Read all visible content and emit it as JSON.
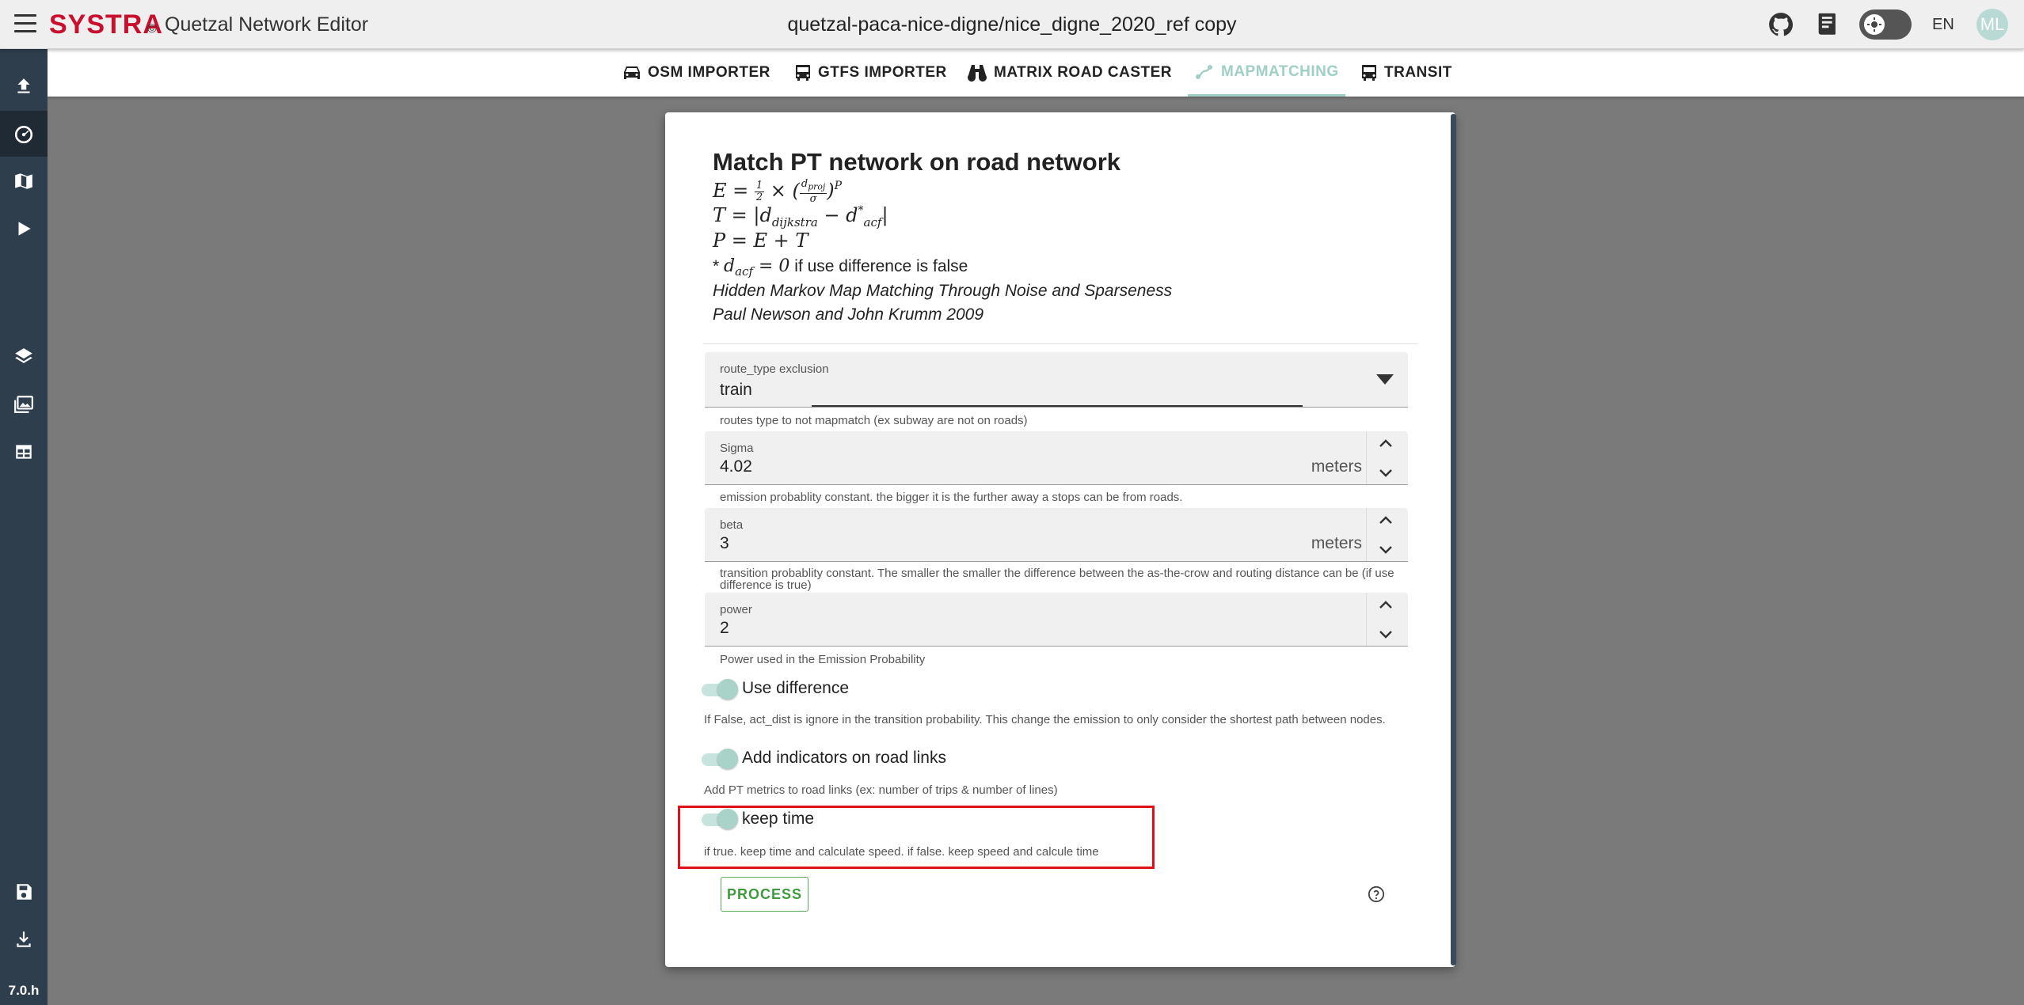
{
  "header": {
    "logo_text": "SYSTRA",
    "copyright_mark": "©",
    "app_name": "Quetzal Network Editor",
    "project_title": "quetzal-paca-nice-digne/nice_digne_2020_ref copy",
    "language": "EN",
    "avatar_initials": "ML"
  },
  "sidebar": {
    "version": "7.0.h",
    "items": [
      {
        "icon": "upload-icon"
      },
      {
        "icon": "speedometer-icon",
        "active": true
      },
      {
        "icon": "map-icon"
      },
      {
        "icon": "play-icon"
      },
      {
        "icon": "layers-icon"
      },
      {
        "icon": "images-icon"
      },
      {
        "icon": "table-icon"
      },
      {
        "icon": "save-icon"
      },
      {
        "icon": "download-icon"
      }
    ]
  },
  "tabs": [
    {
      "label": "OSM IMPORTER",
      "icon": "car-icon"
    },
    {
      "label": "GTFS IMPORTER",
      "icon": "bus-icon"
    },
    {
      "label": "MATRIX ROAD CASTER",
      "icon": "binoculars-icon"
    },
    {
      "label": "MAPMATCHING",
      "icon": "route-icon",
      "active": true
    },
    {
      "label": "TRANSIT",
      "icon": "bus-icon"
    }
  ],
  "dialog": {
    "title": "Match PT network on road network",
    "note_text": "if use difference is false",
    "reference_title": "Hidden Markov Map Matching Through Noise and Sparseness",
    "reference_authors": "Paul Newson and John Krumm 2009",
    "route_type": {
      "label": "route_type exclusion",
      "value": "train",
      "hint": "routes type to not mapmatch (ex subway are not on roads)"
    },
    "sigma": {
      "label": "Sigma",
      "value": "4.02",
      "unit": "meters",
      "hint": "emission probablity constant. the bigger it is the further away a stops can be from roads."
    },
    "beta": {
      "label": "beta",
      "value": "3",
      "unit": "meters",
      "hint": "transition probablity constant. The smaller the smaller the difference between the as-the-crow and routing distance can be (if use difference is true)"
    },
    "power": {
      "label": "power",
      "value": "2",
      "hint": "Power used in the Emission Probability"
    },
    "use_difference": {
      "label": "Use difference",
      "checked": true,
      "hint": "If False, act_dist is ignore in the transition probability. This change the emission to only consider the shortest path between nodes."
    },
    "add_indicators": {
      "label": "Add indicators on road links",
      "checked": true,
      "hint": "Add PT metrics to road links (ex: number of trips & number of lines)"
    },
    "keep_time": {
      "label": "keep time",
      "checked": true,
      "hint": "if true. keep time and calculate speed. if false. keep speed and calcule time"
    },
    "process_label": "PROCESS"
  },
  "colors": {
    "accent": "#9fcfc5",
    "rail": "#2f3e4d",
    "brand": "#c8102e",
    "highlight": "#e0101a",
    "process": "#3f9a3f"
  }
}
